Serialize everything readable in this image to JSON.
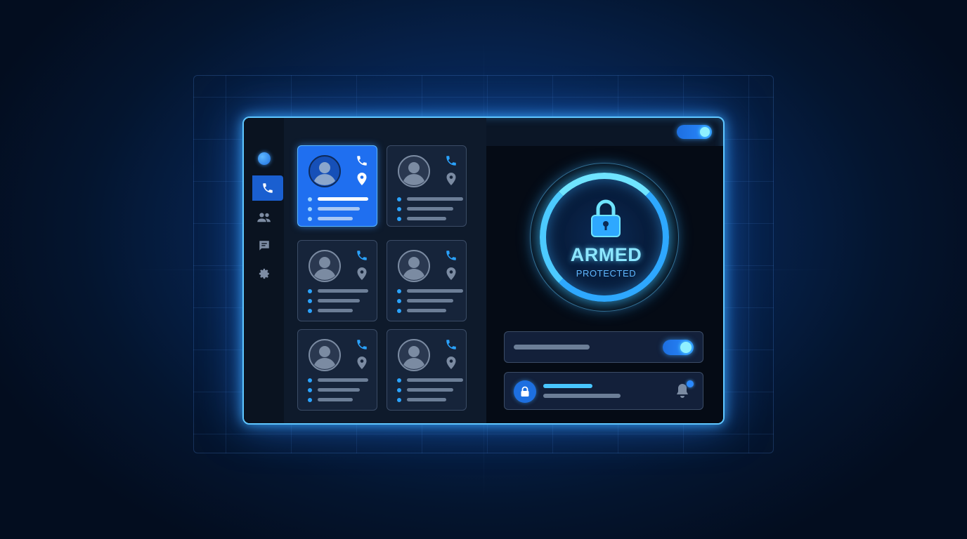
{
  "security_panel": {
    "status_title": "ARMED",
    "status_subtitle": "PROTECTED"
  },
  "sidebar": {
    "items": [
      {
        "name": "logo",
        "icon": "logo-dot"
      },
      {
        "name": "calls",
        "icon": "phone-icon",
        "active": true
      },
      {
        "name": "contacts",
        "icon": "people-icon"
      },
      {
        "name": "messages",
        "icon": "chat-icon"
      },
      {
        "name": "settings",
        "icon": "gear-icon"
      }
    ]
  },
  "contacts": {
    "cards": [
      {
        "selected": true
      },
      {
        "selected": false
      },
      {
        "selected": false
      },
      {
        "selected": false
      },
      {
        "selected": false
      },
      {
        "selected": false
      }
    ]
  },
  "colors": {
    "accent": "#2ea8ff",
    "accent_dark": "#1d6fe0",
    "glow": "#5fc6ff",
    "status_text": "#8ce6ff"
  }
}
